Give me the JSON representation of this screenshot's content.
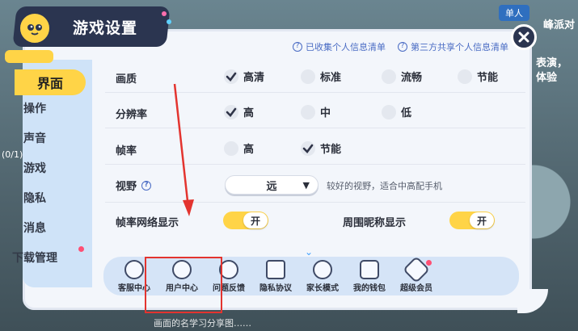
{
  "background": {
    "chip": "单人",
    "topright": "峰派对",
    "right_text": "表演，体验",
    "bottom_text": "画面的名学习分享图……",
    "left_num": "(0/1)"
  },
  "title": "游戏设置",
  "close_icon": "close-icon",
  "top_links": [
    "已收集个人信息清单",
    "第三方共享个人信息清单"
  ],
  "nav": [
    {
      "label": "界面",
      "active": true
    },
    {
      "label": "操作"
    },
    {
      "label": "声音"
    },
    {
      "label": "游戏"
    },
    {
      "label": "隐私"
    },
    {
      "label": "消息"
    },
    {
      "label": "下载管理",
      "badge": true
    }
  ],
  "rows": {
    "quality": {
      "label": "画质",
      "options": [
        "高清",
        "标准",
        "流畅",
        "节能"
      ],
      "selected": "高清"
    },
    "resolution": {
      "label": "分辨率",
      "options": [
        "高",
        "中",
        "低"
      ],
      "selected": "高"
    },
    "framerate": {
      "label": "帧率",
      "options": [
        "高",
        "节能"
      ],
      "selected": "节能"
    },
    "view": {
      "label": "视野",
      "value": "远",
      "hint": "较好的视野，适合中高配手机"
    },
    "netdisplay": {
      "label": "帧率网络显示",
      "toggle": "开"
    },
    "nicknames": {
      "label": "周围昵称显示",
      "toggle": "开"
    }
  },
  "toolbar": [
    {
      "label": "客服中心",
      "icon": "support-icon"
    },
    {
      "label": "用户中心",
      "icon": "user-center-icon"
    },
    {
      "label": "问题反馈",
      "icon": "feedback-icon"
    },
    {
      "label": "隐私协议",
      "icon": "privacy-icon"
    },
    {
      "label": "家长模式",
      "icon": "parent-icon"
    },
    {
      "label": "我的钱包",
      "icon": "wallet-icon"
    },
    {
      "label": "超级会员",
      "icon": "vip-icon"
    }
  ],
  "colors": {
    "accent": "#ffd447",
    "dark": "#2b3550",
    "link": "#4a6cc4",
    "annotation": "#e3342f"
  }
}
